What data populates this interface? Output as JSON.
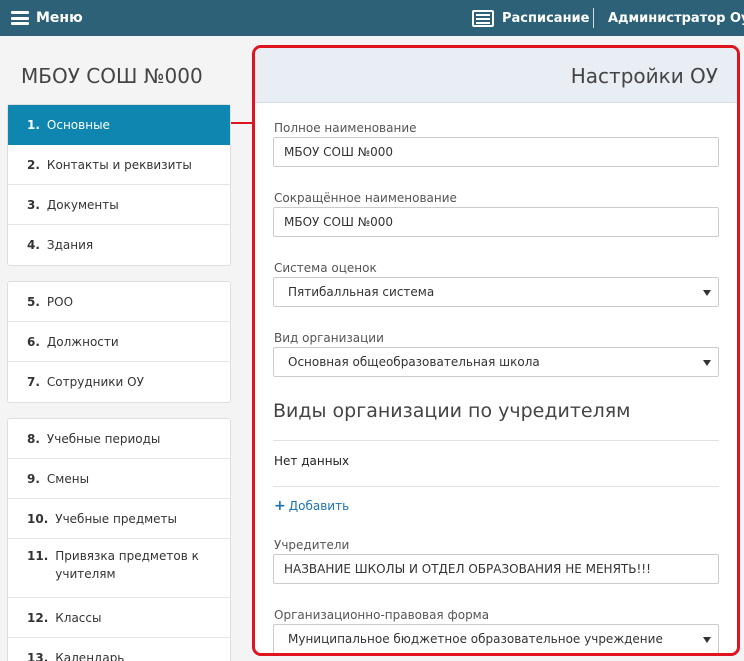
{
  "topbar": {
    "menu_label": "Меню",
    "schedule_label": "Расписание",
    "admin_label": "Администратор Оу"
  },
  "sidebar": {
    "school_title": "МБОУ СОШ №000",
    "groups": [
      [
        {
          "num": "1.",
          "label": "Основные",
          "active": true
        },
        {
          "num": "2.",
          "label": "Контакты и реквизиты"
        },
        {
          "num": "3.",
          "label": "Документы"
        },
        {
          "num": "4.",
          "label": "Здания"
        }
      ],
      [
        {
          "num": "5.",
          "label": "РОО"
        },
        {
          "num": "6.",
          "label": "Должности"
        },
        {
          "num": "7.",
          "label": "Сотрудники ОУ"
        }
      ],
      [
        {
          "num": "8.",
          "label": "Учебные периоды"
        },
        {
          "num": "9.",
          "label": "Смены"
        },
        {
          "num": "10.",
          "label": "Учебные предметы"
        },
        {
          "num": "11.",
          "label": "Привязка предметов к учителям"
        },
        {
          "num": "12.",
          "label": "Классы"
        },
        {
          "num": "13.",
          "label": "Календарь"
        }
      ]
    ]
  },
  "panel": {
    "title": "Настройки ОУ",
    "full_name_label": "Полное наименование",
    "full_name_value": "МБОУ СОШ №000",
    "short_name_label": "Сокращённое наименование",
    "short_name_value": "МБОУ СОШ №000",
    "grading_label": "Система оценок",
    "grading_value": "Пятибалльная система",
    "org_type_label": "Вид организации",
    "org_type_value": "Основная общеобразовательная школа",
    "founders_section_title": "Виды организации по учредителям",
    "no_data": "Нет данных",
    "add_label": "Добавить",
    "founders_label": "Учредители",
    "founders_value": "НАЗВАНИЕ ШКОЛЫ И ОТДЕЛ ОБРАЗОВАНИЯ НЕ МЕНЯТЬ!!!",
    "legal_form_label": "Организационно-правовая форма",
    "legal_form_value": "Муниципальное бюджетное образовательное учреждение"
  },
  "colors": {
    "topbar": "#2d6177",
    "active_item": "#0e86b0",
    "highlight": "#e0141e",
    "link": "#1a72b8"
  }
}
